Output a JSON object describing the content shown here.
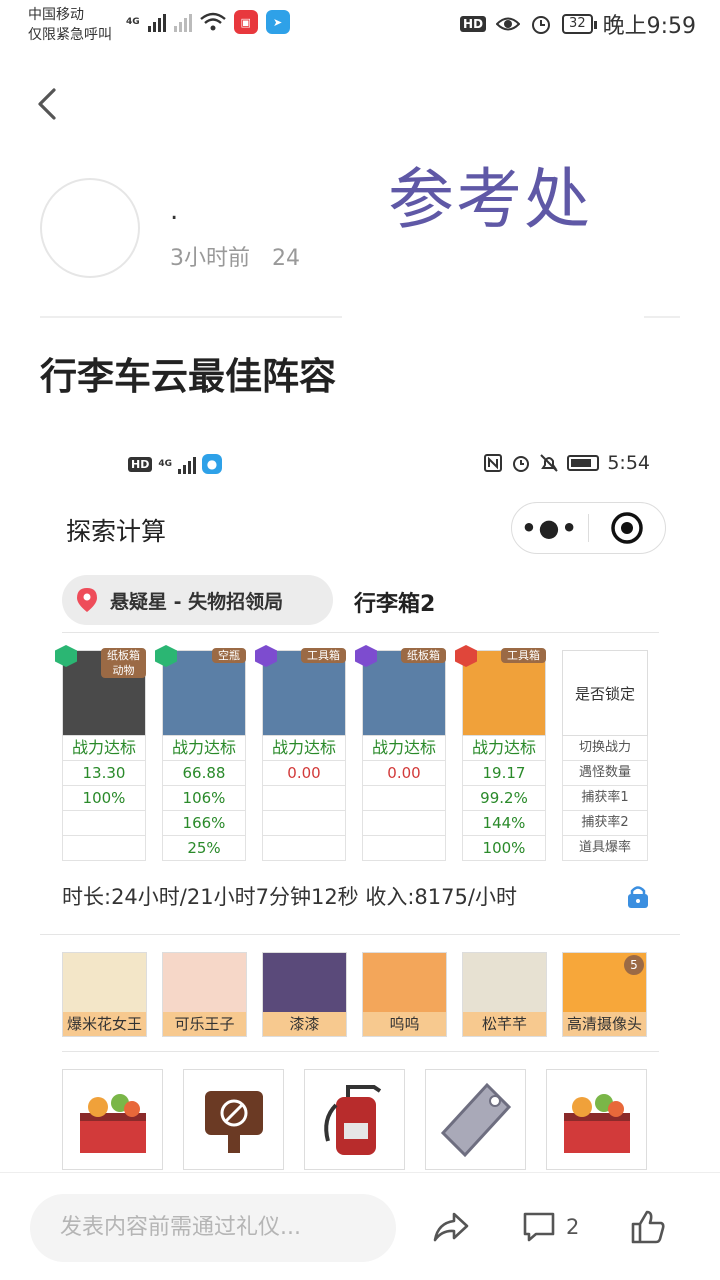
{
  "status_bar": {
    "carrier_line1": "中国移动",
    "carrier_line2": "仅限紧急呼叫",
    "network": "4G",
    "hd": "HD",
    "battery": "32",
    "time": "晚上9:59"
  },
  "post": {
    "author": ".",
    "time_ago": "3小时前",
    "views": "24",
    "stamp": "参考处",
    "title": "行李车云最佳阵容"
  },
  "embedded": {
    "status": {
      "network": "4G",
      "hd": "HD",
      "time": "5:54"
    },
    "app_title": "探索计算",
    "capsule_dots": "•●•",
    "location": "悬疑星 - 失物招领局",
    "location_name": "行李箱2",
    "team": [
      {
        "tag": "纸板箱",
        "tag2": "动物",
        "header": "战力达标",
        "stats": [
          "13.30",
          "100%",
          "",
          ""
        ],
        "stat_red": false,
        "gem_color": "#2bb673",
        "bg": "#4a4a4a"
      },
      {
        "tag": "空瓶",
        "tag2": "",
        "header": "战力达标",
        "stats": [
          "66.88",
          "106%",
          "166%",
          "25%"
        ],
        "stat_red": false,
        "gem_color": "#2bb673",
        "bg": "#5b7fa6"
      },
      {
        "tag": "工具箱",
        "tag2": "",
        "header": "战力达标",
        "stats": [
          "0.00",
          "",
          "",
          ""
        ],
        "stat_red": true,
        "gem_color": "#7d4ccf",
        "bg": "#5b7fa6"
      },
      {
        "tag": "纸板箱",
        "tag2": "",
        "header": "战力达标",
        "stats": [
          "0.00",
          "",
          "",
          ""
        ],
        "stat_red": true,
        "gem_color": "#7d4ccf",
        "bg": "#5b7fa6"
      },
      {
        "tag": "工具箱",
        "tag2": "",
        "header": "战力达标",
        "stats": [
          "19.17",
          "99.2%",
          "144%",
          "100%"
        ],
        "stat_red": false,
        "gem_color": "#e0463a",
        "bg": "#f0a13a"
      }
    ],
    "lock_column": {
      "header": "是否锁定",
      "rows": [
        "切换战力",
        "遇怪数量",
        "捕获率1",
        "捕获率2",
        "道具爆率"
      ]
    },
    "summary": "时长:24小时/21小时7分钟12秒 收入:8175/小时",
    "pets": [
      {
        "name": "爆米花女王",
        "color": "#f3e6c8"
      },
      {
        "name": "可乐王子",
        "color": "#f6d7c8"
      },
      {
        "name": "漆漆",
        "color": "#5a4a7a"
      },
      {
        "name": "呜呜",
        "color": "#f3a65a"
      },
      {
        "name": "松芊芊",
        "color": "#e7e1d2"
      },
      {
        "name": "高清摄像头",
        "color": "#f7a73a",
        "badge": "5"
      }
    ],
    "items": [
      {
        "icon": "food-box-icon"
      },
      {
        "icon": "no-sign-icon"
      },
      {
        "icon": "fire-extinguisher-icon"
      },
      {
        "icon": "tag-icon"
      },
      {
        "icon": "food-box-icon"
      }
    ]
  },
  "bottom_bar": {
    "comment_placeholder": "发表内容前需通过礼仪...",
    "comment_count": "2"
  }
}
